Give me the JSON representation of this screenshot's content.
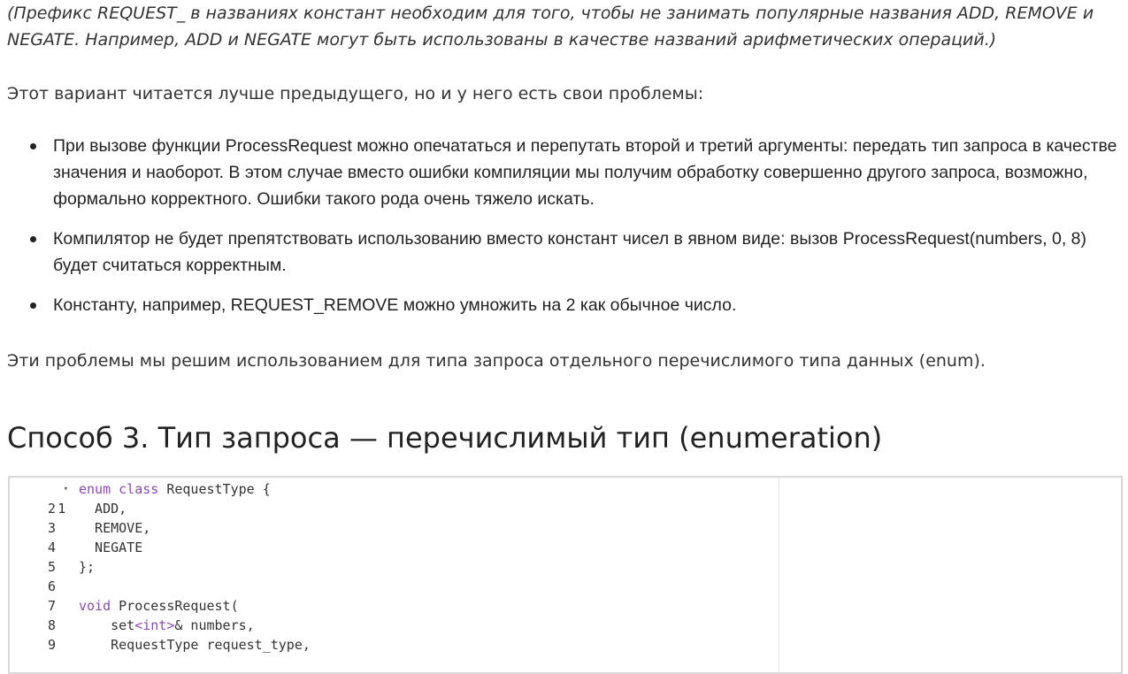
{
  "intro_note": "(Префикс REQUEST_ в названиях констант необходим для того, чтобы не занимать популярные названия ADD, REMOVE и NEGATE. Например, ADD и NEGATE могут быть использованы в качестве названий арифметических операций.)",
  "variant_paragraph": "Этот вариант читается лучше предыдущего, но и у него есть свои проблемы:",
  "problems": [
    "При вызове функции ProcessRequest можно опечататься и перепутать второй и третий аргументы: передать тип запроса в качестве значения и наоборот. В этом случае вместо ошибки компиляции мы получим обработку совершенно другого запроса, возможно, формально корректного. Ошибки такого рода очень тяжело искать.",
    "Компилятор не будет препятствовать использованию вместо констант чисел в явном виде: вызов ProcessRequest(numbers, 0, 8) будет считаться корректным.",
    "Константу, например, REQUEST_REMOVE можно умножить на 2 как обычное число."
  ],
  "solution_paragraph": "Эти проблемы мы решим использованием для типа запроса отдельного перечислимого типа данных (enum).",
  "section_heading": "Способ 3. Тип запроса — перечислимый тип (enumeration)",
  "code": {
    "fold_marker": "▾",
    "line_numbers": [
      "1",
      "2",
      "3",
      "4",
      "5",
      "6",
      "7",
      "8",
      "9"
    ],
    "line1": {
      "kw1": "enum",
      "sp": " ",
      "kw2": "class",
      "rest": " RequestType {"
    },
    "line2": "  ADD,",
    "line3": "  REMOVE,",
    "line4": "  NEGATE",
    "line5": "};",
    "line6": "",
    "line7": {
      "kw": "void",
      "rest": " ProcessRequest("
    },
    "line8": {
      "indent": "    set",
      "lt": "<",
      "kw": "int",
      "gt": ">",
      "rest": "& numbers,"
    },
    "line9": "    RequestType request_type,"
  },
  "colors": {
    "text": "#333333",
    "keyword": "#8a4baf",
    "code_border": "#d8d8d8"
  }
}
